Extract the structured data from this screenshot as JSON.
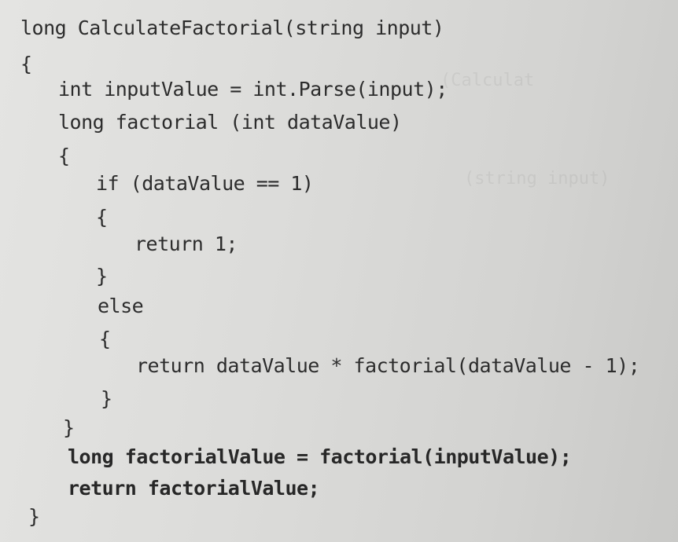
{
  "code": {
    "lines": [
      "long CalculateFactorial(string input)",
      "{",
      "int inputValue = int.Parse(input);",
      "long factorial (int dataValue)",
      "{",
      "if (dataValue == 1)",
      "{",
      "return 1;",
      "}",
      "else",
      "{",
      "return dataValue * factorial(dataValue - 1);",
      "}",
      "}",
      "long factorialValue = factorial(inputValue);",
      "return factorialValue;",
      "}"
    ]
  }
}
